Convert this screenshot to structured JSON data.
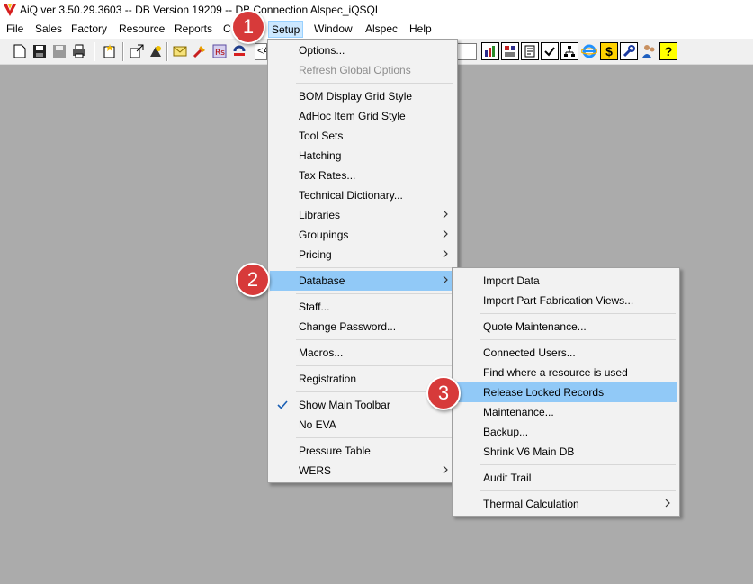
{
  "window": {
    "title": "AiQ ver 3.50.29.3603 -- DB Version 19209 -- DB Connection Alspec_iQSQL"
  },
  "menubar": {
    "items": [
      "File",
      "Sales",
      "Factory",
      "Resource",
      "Reports",
      "C",
      "Setup",
      "Window",
      "Alspec",
      "Help"
    ],
    "active": "Setup"
  },
  "toolbar": {
    "field_text": "<A",
    "icons": [
      "new-document-icon",
      "save-icon",
      "save-all-icon",
      "print-icon",
      "new-quote-icon",
      "import-icon",
      "schedule-icon",
      "mail-icon",
      "tools-icon",
      "report-icon",
      "alspec-logo-icon",
      "bar-chart-icon",
      "pivot-icon",
      "settings-icon",
      "check-icon",
      "org-chart-icon",
      "internet-explorer-icon",
      "pricing-icon",
      "wrench-icon",
      "users-icon",
      "help-icon"
    ],
    "accent_colors": {
      "pricing": "#ffd200",
      "help": "#ffff00",
      "ie": "#1e90ff"
    }
  },
  "setup_menu": {
    "items": [
      {
        "label": "Options...",
        "disabled": false
      },
      {
        "label": "Refresh Global Options",
        "disabled": true
      },
      {
        "label": "BOM Display Grid Style"
      },
      {
        "label": "AdHoc Item Grid Style"
      },
      {
        "label": "Tool Sets"
      },
      {
        "label": "Hatching"
      },
      {
        "label": "Tax Rates..."
      },
      {
        "label": "Technical Dictionary..."
      },
      {
        "label": "Libraries",
        "submenu": true
      },
      {
        "label": "Groupings",
        "submenu": true
      },
      {
        "label": "Pricing",
        "submenu": true
      },
      {
        "label": "Database",
        "submenu": true,
        "highlighted": true
      },
      {
        "label": "Staff..."
      },
      {
        "label": "Change Password..."
      },
      {
        "label": "Macros..."
      },
      {
        "label": "Registration"
      },
      {
        "label": "Show Main Toolbar",
        "checked": true
      },
      {
        "label": "No EVA"
      },
      {
        "label": "Pressure Table"
      },
      {
        "label": "WERS",
        "submenu": true
      }
    ]
  },
  "database_menu": {
    "items": [
      {
        "label": "Import Data"
      },
      {
        "label": "Import Part Fabrication Views..."
      },
      {
        "label": "Quote Maintenance..."
      },
      {
        "label": "Connected Users..."
      },
      {
        "label": "Find where a resource is used"
      },
      {
        "label": "Release Locked Records",
        "highlighted": true
      },
      {
        "label": "Maintenance..."
      },
      {
        "label": "Backup..."
      },
      {
        "label": "Shrink V6 Main DB"
      },
      {
        "label": "Audit Trail"
      },
      {
        "label": "Thermal Calculation",
        "submenu": true
      }
    ]
  },
  "step_badges": [
    "1",
    "2",
    "3"
  ],
  "colors": {
    "highlight": "#91c9f7",
    "badge": "#d73a3a",
    "workspace": "#ababab",
    "menu_bg": "#f2f2f2"
  }
}
